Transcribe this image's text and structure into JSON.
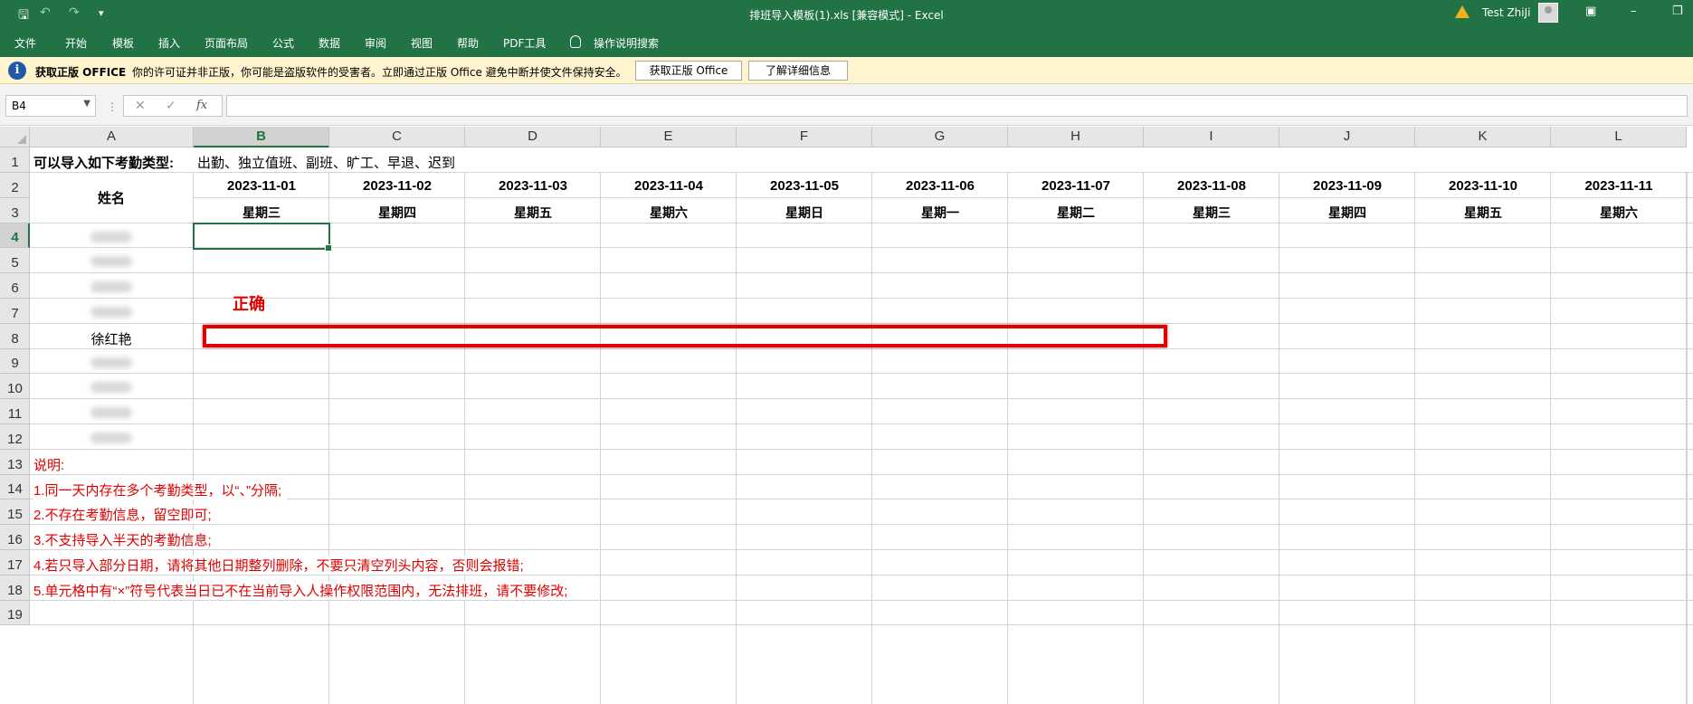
{
  "window": {
    "title": "排班导入模板(1).xls  [兼容模式]  -  Excel",
    "user_name": "Test ZhiJi",
    "accent_color": "#217346",
    "icons": [
      "save-icon",
      "undo-icon",
      "redo-icon",
      "customize-icon",
      "warning-icon",
      "avatar",
      "ribbon-display-icon",
      "minimize-icon",
      "restore-icon"
    ]
  },
  "menu": {
    "items": [
      "文件",
      "开始",
      "模板",
      "插入",
      "页面布局",
      "公式",
      "数据",
      "审阅",
      "视图",
      "帮助",
      "PDF工具"
    ],
    "search_label": "操作说明搜索"
  },
  "notice": {
    "title": "获取正版 OFFICE",
    "message": "你的许可证并非正版，你可能是盗版软件的受害者。立即通过正版 Office 避免中断并使文件保持安全。",
    "btn_get": "获取正版 Office",
    "btn_learn": "了解详细信息"
  },
  "formula_bar": {
    "cell_ref": "B4",
    "fx": "fx",
    "content": ""
  },
  "sheet": {
    "columns": [
      "A",
      "B",
      "C",
      "D",
      "E",
      "F",
      "G",
      "H",
      "I",
      "J",
      "K",
      "L"
    ],
    "selected_column": "B",
    "selected_row": "4",
    "rows": [
      "1",
      "2",
      "3",
      "4",
      "5",
      "6",
      "7",
      "8",
      "9",
      "10",
      "11",
      "12",
      "13",
      "14",
      "15",
      "16",
      "17",
      "18",
      "19"
    ],
    "row1_title": "可以导入如下考勤类型:",
    "row1_types": "出勤、独立值班、副班、旷工、早退、迟到",
    "name_header": "姓名",
    "dates": [
      "2023-11-01",
      "2023-11-02",
      "2023-11-03",
      "2023-11-04",
      "2023-11-05",
      "2023-11-06",
      "2023-11-07",
      "2023-11-08",
      "2023-11-09",
      "2023-11-10",
      "2023-11-11"
    ],
    "weekdays": [
      "星期三",
      "星期四",
      "星期五",
      "星期六",
      "星期日",
      "星期一",
      "星期二",
      "星期三",
      "星期四",
      "星期五",
      "星期六"
    ],
    "visible_name": "徐红艳",
    "notes": [
      "说明:",
      "1.同一天内存在多个考勤类型，以“、”分隔;",
      "2.不存在考勤信息，留空即可;",
      "3.不支持导入半天的考勤信息;",
      "4.若只导入部分日期，请将其他日期整列删除，不要只清空列头内容，否则会报错;",
      "5.单元格中有“×”符号代表当日已不在当前导入人操作权限范围内，无法排班，请不要修改;"
    ]
  },
  "annotation": {
    "label": "正确",
    "color": "#e00000"
  }
}
